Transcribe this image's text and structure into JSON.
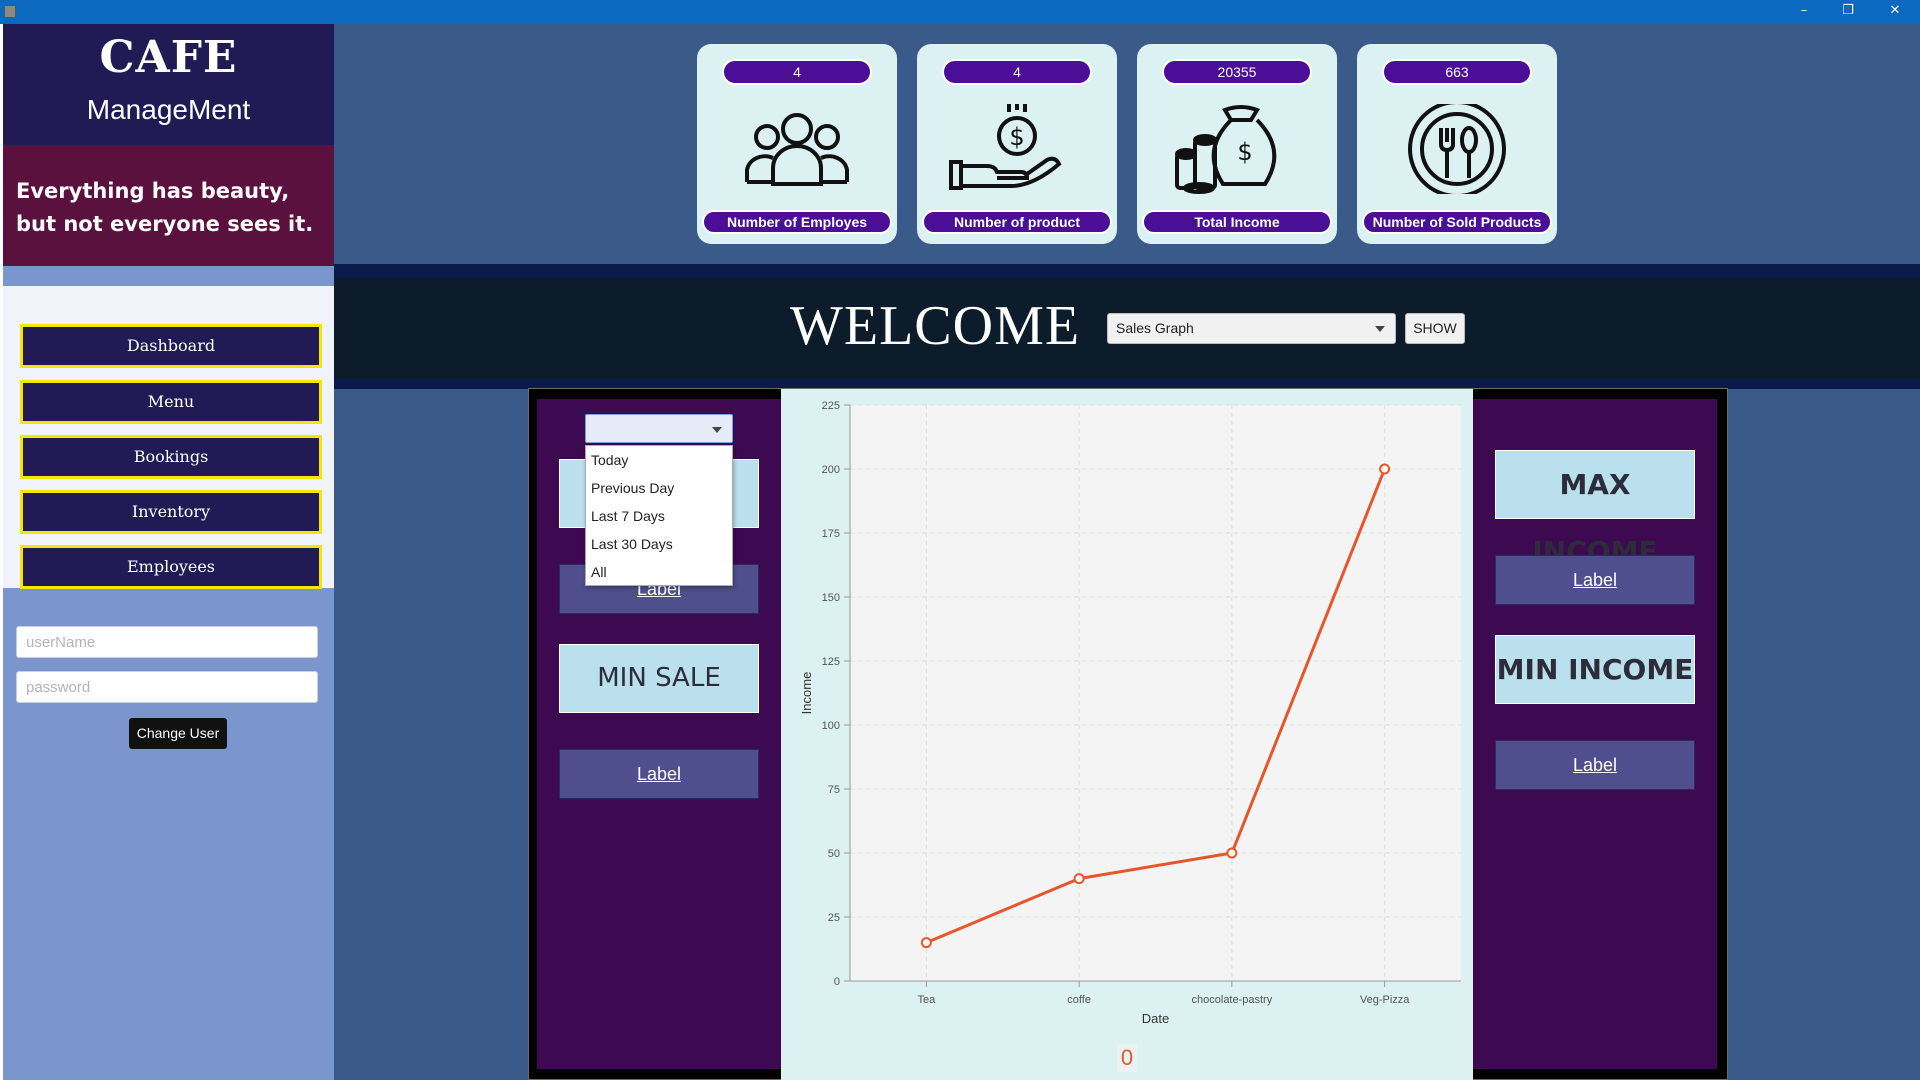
{
  "window": {
    "controls": [
      "–",
      "❐",
      "✕"
    ]
  },
  "sidebar": {
    "brand_title": "CAFE",
    "brand_subtitle": "ManageMent",
    "quote": "Everything has beauty, but not everyone sees it.",
    "nav": [
      "Dashboard",
      "Menu",
      "Bookings",
      "Inventory",
      "Employees"
    ],
    "username_placeholder": "userName",
    "password_placeholder": "password",
    "change_user_label": "Change User"
  },
  "stats": [
    {
      "value": "4",
      "label": "Number of Employes",
      "icon": "people-icon"
    },
    {
      "value": "4",
      "label": "Number of product",
      "icon": "money-hand-icon"
    },
    {
      "value": "20355",
      "label": "Total Income",
      "icon": "money-bag-icon"
    },
    {
      "value": "663",
      "label": "Number of Sold Products",
      "icon": "plate-cutlery-icon"
    }
  ],
  "welcome": {
    "title": "WELCOME",
    "graph_select_value": "Sales Graph",
    "show_label": "SHOW"
  },
  "left_panel": {
    "range_select_value": "",
    "range_options": [
      "Today",
      "Previous Day",
      "Last 7 Days",
      "Last 30 Days",
      "All"
    ],
    "max_label": "Label",
    "min_title": "MIN SALE",
    "min_label": "Label"
  },
  "right_panel": {
    "max_title": "MAX INCOME",
    "max_label": "Label",
    "min_title": "MIN INCOME",
    "min_label": "Label"
  },
  "chart_zero": "0",
  "colors": {
    "accent_purple": "#4a0f96",
    "nav_border_yellow": "#f3e600",
    "line_orange": "#e8552b"
  },
  "chart_data": {
    "type": "line",
    "categories": [
      "Tea",
      "coffe",
      "chocolate-pastry",
      "Veg-Pizza"
    ],
    "values": [
      15,
      40,
      50,
      200
    ],
    "xlabel": "Date",
    "ylabel": "Income",
    "ylim": [
      0,
      225
    ],
    "yticks": [
      0,
      25,
      50,
      75,
      100,
      125,
      150,
      175,
      200,
      225
    ],
    "grid": true
  }
}
